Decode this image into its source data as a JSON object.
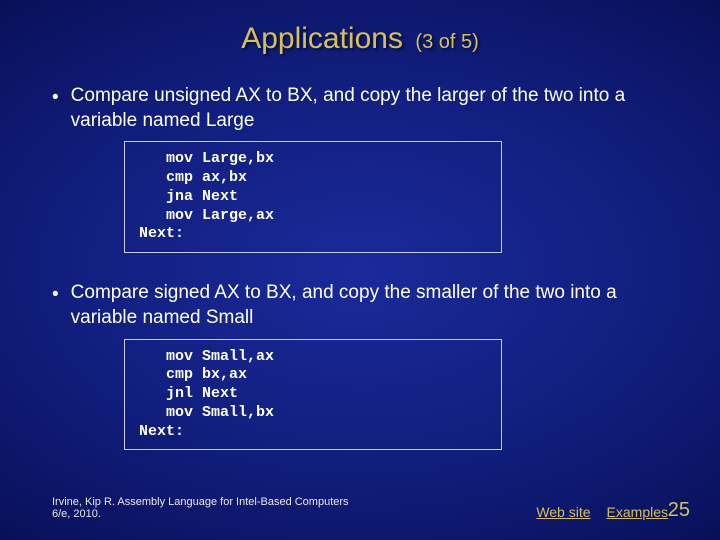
{
  "title": {
    "main": "Applications",
    "sub": "(3 of 5)"
  },
  "bullets": [
    "Compare unsigned AX to BX, and copy the larger of the two into a variable named Large",
    "Compare signed AX to BX, and copy the smaller of the two into a variable named Small"
  ],
  "code": [
    "   mov Large,bx\n   cmp ax,bx\n   jna Next\n   mov Large,ax\nNext:",
    "   mov Small,ax\n   cmp bx,ax\n   jnl Next\n   mov Small,bx\nNext:"
  ],
  "footer": {
    "credit": "Irvine, Kip R. Assembly Language for Intel-Based Computers 6/e, 2010.",
    "link_web": "Web site",
    "link_examples": "Examples"
  },
  "slide_number": "25"
}
